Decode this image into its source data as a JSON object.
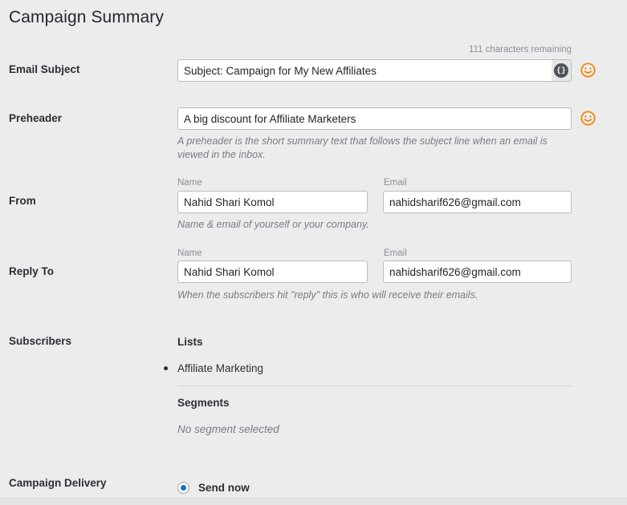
{
  "page": {
    "title": "Campaign Summary",
    "background_color": "#ececec"
  },
  "email_subject": {
    "label": "Email Subject",
    "chars_remaining": "111 characters remaining",
    "value": "Subject: Campaign for My New Affiliates",
    "placeholder": "Subject",
    "merge_tag_icon": "curly-braces-icon",
    "merge_tag_glyph": "{}",
    "emoji_icon": "smiley-face-icon"
  },
  "preheader": {
    "label": "Preheader",
    "value": "A big discount for Affiliate Marketers",
    "placeholder": "Preheader",
    "help": "A preheader is the short summary text that follows the subject line when an email is viewed in the inbox.",
    "emoji_icon": "smiley-face-icon"
  },
  "from": {
    "label": "From",
    "name_label": "Name",
    "name_value": "Nahid Shari Komol",
    "email_label": "Email",
    "email_value": "nahidsharif626@gmail.com",
    "help": "Name & email of yourself or your company."
  },
  "reply_to": {
    "label": "Reply To",
    "name_label": "Name",
    "name_value": "Nahid Shari Komol",
    "email_label": "Email",
    "email_value": "nahidsharif626@gmail.com",
    "help": "When the subscribers hit \"reply\" this is who will receive their emails."
  },
  "subscribers": {
    "label": "Subscribers",
    "lists_heading": "Lists",
    "lists": [
      "Affiliate Marketing"
    ],
    "segments_heading": "Segments",
    "segments_empty": "No segment selected"
  },
  "campaign_delivery": {
    "label": "Campaign Delivery",
    "options": [
      {
        "label": "Send now",
        "selected": true
      }
    ],
    "selected_label": "Send now",
    "accent_color": "#1f6fc4"
  },
  "colors": {
    "background": "#ececec",
    "text": "#2b2f33",
    "muted": "#787d83",
    "sub_label": "#8b9096",
    "input_border": "#b9bcc0",
    "accent_orange": "#ef8200",
    "accent_blue": "#1f6fc4",
    "merge_circle": "#4e5459"
  }
}
